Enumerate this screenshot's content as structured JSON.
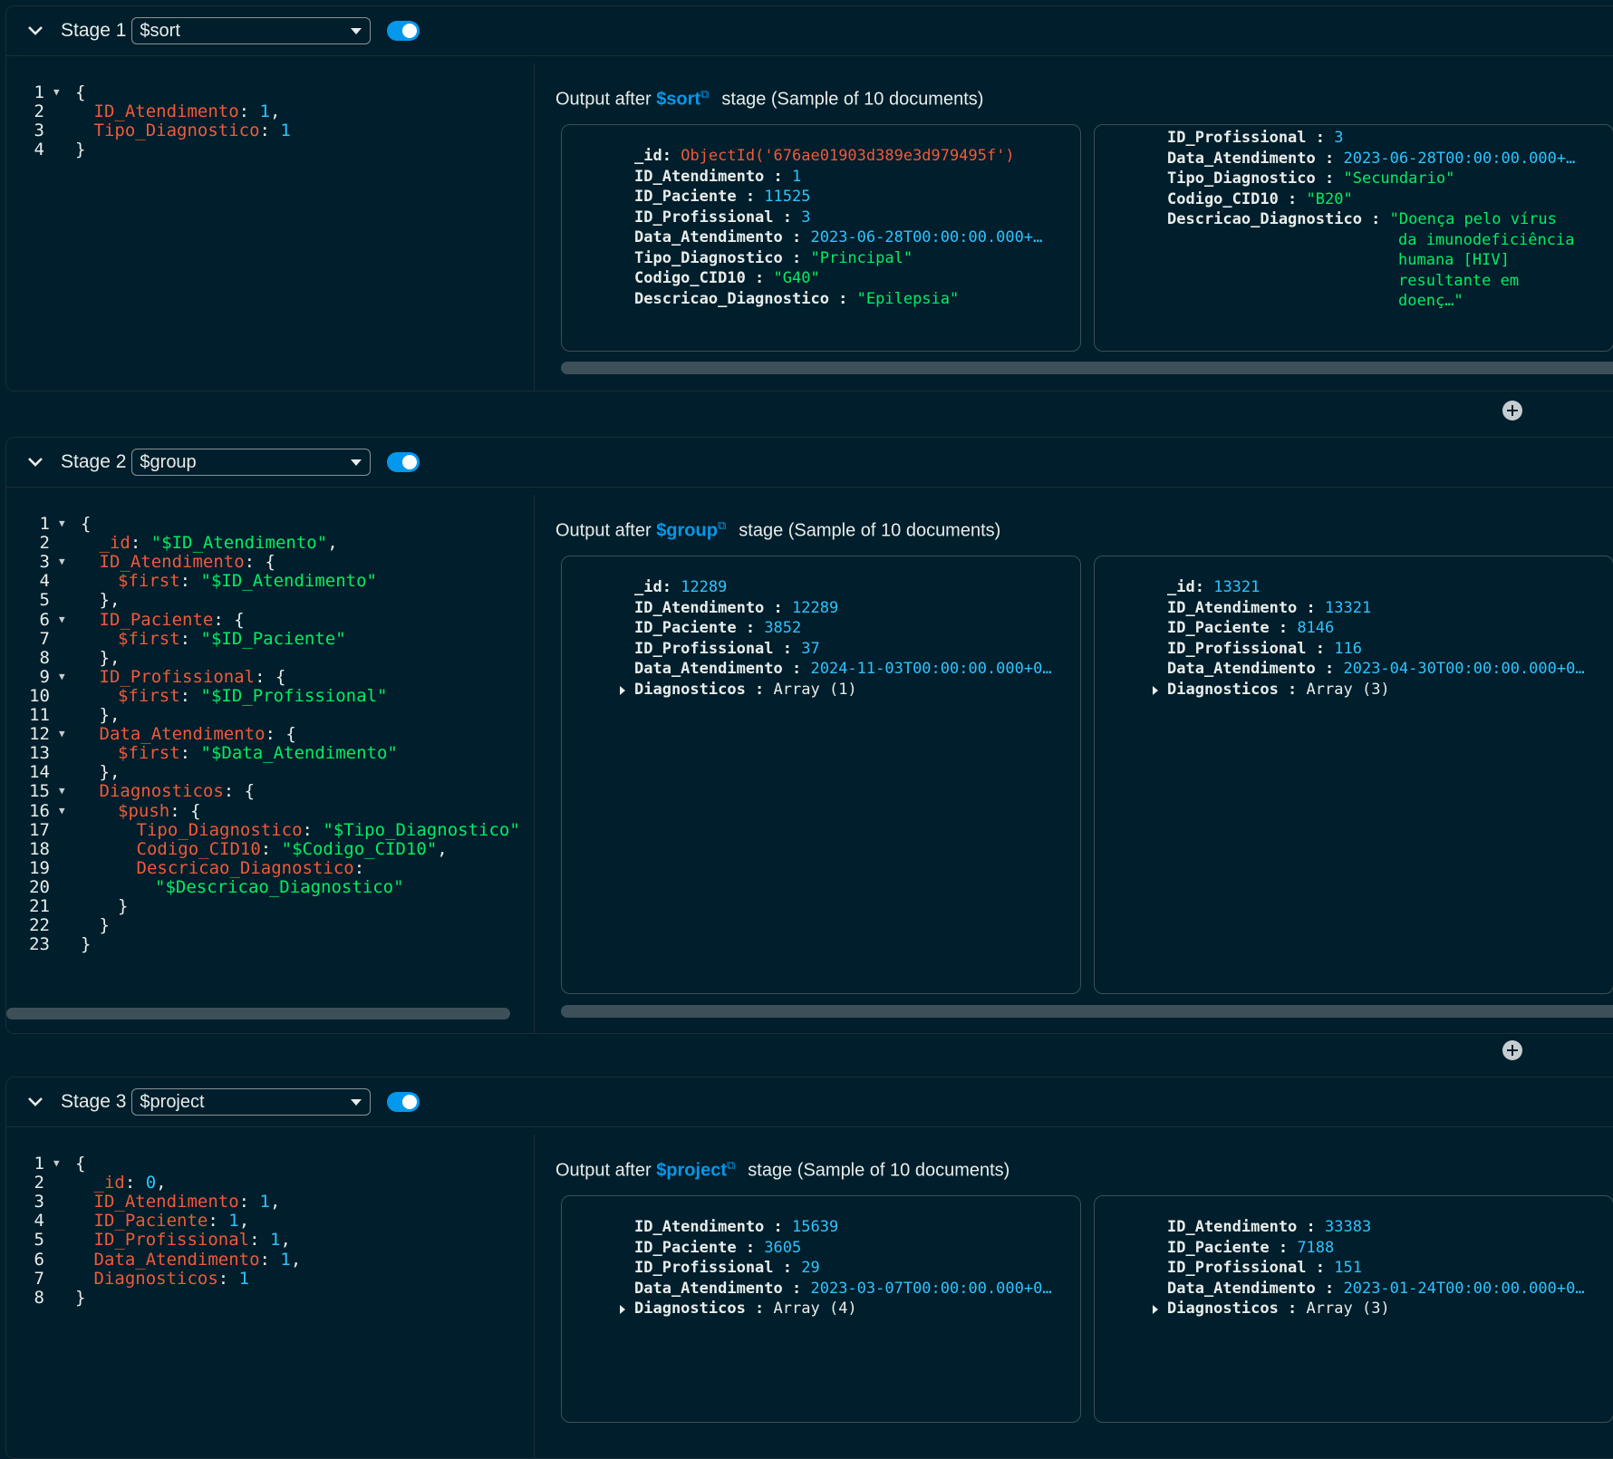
{
  "stages": [
    {
      "title": "Stage 1",
      "operator": "$sort",
      "enabled": true,
      "code": [
        [
          [
            "p",
            "{"
          ]
        ],
        [
          [
            "k",
            "ID_Atendimento"
          ],
          [
            "p",
            ": "
          ],
          [
            "n",
            "1"
          ],
          [
            "p",
            ","
          ]
        ],
        [
          [
            "k",
            "Tipo_Diagnostico"
          ],
          [
            "p",
            ": "
          ],
          [
            "n",
            "1"
          ]
        ],
        [
          [
            "p",
            "}"
          ]
        ]
      ],
      "folds": [
        1
      ],
      "indents": [
        0,
        1,
        1,
        0
      ],
      "output_prefix": "Output after",
      "output_op": "$sort",
      "output_suffix": "stage (Sample of 10 documents)",
      "docs": [
        {
          "fields": [
            [
              "_id:",
              "ObjectId('676ae01903d389e3d979495f')",
              "o",
              false
            ],
            [
              "ID_Atendimento :",
              "1",
              "n",
              false
            ],
            [
              "ID_Paciente :",
              "11525",
              "n",
              false
            ],
            [
              "ID_Profissional :",
              "3",
              "n",
              false
            ],
            [
              "Data_Atendimento :",
              "2023-06-28T00:00:00.000+…",
              "n",
              false
            ],
            [
              "Tipo_Diagnostico :",
              "\"Principal\"",
              "s",
              false
            ],
            [
              "Codigo_CID10 :",
              "\"G40\"",
              "s",
              false
            ],
            [
              "Descricao_Diagnostico :",
              "\"Epilepsia\"",
              "s",
              false
            ]
          ]
        },
        {
          "fields": [
            [
              "ID_Profissional :",
              "3",
              "n",
              false
            ],
            [
              "Data_Atendimento :",
              "2023-06-28T00:00:00.000+…",
              "n",
              false
            ],
            [
              "Tipo_Diagnostico :",
              "\"Secundario\"",
              "s",
              false
            ],
            [
              "Codigo_CID10 :",
              "\"B20\"",
              "s",
              false
            ],
            [
              "Descricao_Diagnostico :",
              "\"Doença pelo vírus",
              "s",
              false
            ],
            [
              "",
              "da imunodeficiência",
              "s",
              false
            ],
            [
              "",
              "humana [HIV]",
              "s",
              false
            ],
            [
              "",
              "resultante em",
              "s",
              false
            ],
            [
              "",
              "doenç…\"",
              "s",
              false
            ]
          ]
        }
      ]
    },
    {
      "title": "Stage 2",
      "operator": "$group",
      "enabled": true,
      "code": [
        [
          [
            "p",
            "{"
          ]
        ],
        [
          [
            "k",
            "_id"
          ],
          [
            "p",
            ": "
          ],
          [
            "s",
            "\"$ID_Atendimento\""
          ],
          [
            "p",
            ","
          ]
        ],
        [
          [
            "k",
            "ID_Atendimento"
          ],
          [
            "p",
            ": {"
          ]
        ],
        [
          [
            "k",
            "$first"
          ],
          [
            "p",
            ": "
          ],
          [
            "s",
            "\"$ID_Atendimento\""
          ]
        ],
        [
          [
            "p",
            "},"
          ]
        ],
        [
          [
            "k",
            "ID_Paciente"
          ],
          [
            "p",
            ": {"
          ]
        ],
        [
          [
            "k",
            "$first"
          ],
          [
            "p",
            ": "
          ],
          [
            "s",
            "\"$ID_Paciente\""
          ]
        ],
        [
          [
            "p",
            "},"
          ]
        ],
        [
          [
            "k",
            "ID_Profissional"
          ],
          [
            "p",
            ": {"
          ]
        ],
        [
          [
            "k",
            "$first"
          ],
          [
            "p",
            ": "
          ],
          [
            "s",
            "\"$ID_Profissional\""
          ]
        ],
        [
          [
            "p",
            "},"
          ]
        ],
        [
          [
            "k",
            "Data_Atendimento"
          ],
          [
            "p",
            ": {"
          ]
        ],
        [
          [
            "k",
            "$first"
          ],
          [
            "p",
            ": "
          ],
          [
            "s",
            "\"$Data_Atendimento\""
          ]
        ],
        [
          [
            "p",
            "},"
          ]
        ],
        [
          [
            "k",
            "Diagnosticos"
          ],
          [
            "p",
            ": {"
          ]
        ],
        [
          [
            "k",
            "$push"
          ],
          [
            "p",
            ": {"
          ]
        ],
        [
          [
            "k",
            "Tipo_Diagnostico"
          ],
          [
            "p",
            ": "
          ],
          [
            "s",
            "\"$Tipo_Diagnostico\""
          ]
        ],
        [
          [
            "k",
            "Codigo_CID10"
          ],
          [
            "p",
            ": "
          ],
          [
            "s",
            "\"$Codigo_CID10\""
          ],
          [
            "p",
            ","
          ]
        ],
        [
          [
            "k",
            "Descricao_Diagnostico"
          ],
          [
            "p",
            ":"
          ]
        ],
        [
          [
            "s",
            "\"$Descricao_Diagnostico\""
          ]
        ],
        [
          [
            "p",
            "}"
          ]
        ],
        [
          [
            "p",
            "}"
          ]
        ],
        [
          [
            "p",
            "}"
          ]
        ]
      ],
      "folds": [
        1,
        3,
        6,
        9,
        12,
        15,
        16
      ],
      "indents": [
        0,
        1,
        1,
        2,
        1,
        1,
        2,
        1,
        1,
        2,
        1,
        1,
        2,
        1,
        1,
        2,
        3,
        3,
        3,
        4,
        2,
        1,
        0
      ],
      "output_prefix": "Output after",
      "output_op": "$group",
      "output_suffix": "stage (Sample of 10 documents)",
      "docs": [
        {
          "fields": [
            [
              "_id:",
              "12289",
              "n",
              false
            ],
            [
              "ID_Atendimento :",
              "12289",
              "n",
              false
            ],
            [
              "ID_Paciente :",
              "3852",
              "n",
              false
            ],
            [
              "ID_Profissional :",
              "37",
              "n",
              false
            ],
            [
              "Data_Atendimento :",
              "2024-11-03T00:00:00.000+0…",
              "n",
              false
            ],
            [
              "Diagnosticos :",
              "Array (1)",
              "p",
              true
            ]
          ]
        },
        {
          "fields": [
            [
              "_id:",
              "13321",
              "n",
              false
            ],
            [
              "ID_Atendimento :",
              "13321",
              "n",
              false
            ],
            [
              "ID_Paciente :",
              "8146",
              "n",
              false
            ],
            [
              "ID_Profissional :",
              "116",
              "n",
              false
            ],
            [
              "Data_Atendimento :",
              "2023-04-30T00:00:00.000+0…",
              "n",
              false
            ],
            [
              "Diagnosticos :",
              "Array (3)",
              "p",
              true
            ]
          ]
        }
      ]
    },
    {
      "title": "Stage 3",
      "operator": "$project",
      "enabled": true,
      "code": [
        [
          [
            "p",
            "{"
          ]
        ],
        [
          [
            "k",
            "_id"
          ],
          [
            "p",
            ": "
          ],
          [
            "n",
            "0"
          ],
          [
            "p",
            ","
          ]
        ],
        [
          [
            "k",
            "ID_Atendimento"
          ],
          [
            "p",
            ": "
          ],
          [
            "n",
            "1"
          ],
          [
            "p",
            ","
          ]
        ],
        [
          [
            "k",
            "ID_Paciente"
          ],
          [
            "p",
            ": "
          ],
          [
            "n",
            "1"
          ],
          [
            "p",
            ","
          ]
        ],
        [
          [
            "k",
            "ID_Profissional"
          ],
          [
            "p",
            ": "
          ],
          [
            "n",
            "1"
          ],
          [
            "p",
            ","
          ]
        ],
        [
          [
            "k",
            "Data_Atendimento"
          ],
          [
            "p",
            ": "
          ],
          [
            "n",
            "1"
          ],
          [
            "p",
            ","
          ]
        ],
        [
          [
            "k",
            "Diagnosticos"
          ],
          [
            "p",
            ": "
          ],
          [
            "n",
            "1"
          ]
        ],
        [
          [
            "p",
            "}"
          ]
        ]
      ],
      "folds": [
        1
      ],
      "indents": [
        0,
        1,
        1,
        1,
        1,
        1,
        1,
        0
      ],
      "output_prefix": "Output after",
      "output_op": "$project",
      "output_suffix": "stage (Sample of 10 documents)",
      "docs": [
        {
          "fields": [
            [
              "ID_Atendimento :",
              "15639",
              "n",
              false
            ],
            [
              "ID_Paciente :",
              "3605",
              "n",
              false
            ],
            [
              "ID_Profissional :",
              "29",
              "n",
              false
            ],
            [
              "Data_Atendimento :",
              "2023-03-07T00:00:00.000+0…",
              "n",
              false
            ],
            [
              "Diagnosticos :",
              "Array (4)",
              "p",
              true
            ]
          ]
        },
        {
          "fields": [
            [
              "ID_Atendimento :",
              "33383",
              "n",
              false
            ],
            [
              "ID_Paciente :",
              "7188",
              "n",
              false
            ],
            [
              "ID_Profissional :",
              "151",
              "n",
              false
            ],
            [
              "Data_Atendimento :",
              "2023-01-24T00:00:00.000+0…",
              "n",
              false
            ],
            [
              "Diagnosticos :",
              "Array (3)",
              "p",
              true
            ]
          ]
        }
      ]
    }
  ],
  "icons": {
    "collapse": "chevron-down-icon",
    "add_stage": "plus-circle-icon",
    "external_link": "external-link-icon"
  },
  "colors": {
    "background": "#001e2b",
    "key": "#ef5a3a",
    "string": "#00ed64",
    "number": "#2dc4ff",
    "accent": "#0498ec"
  }
}
